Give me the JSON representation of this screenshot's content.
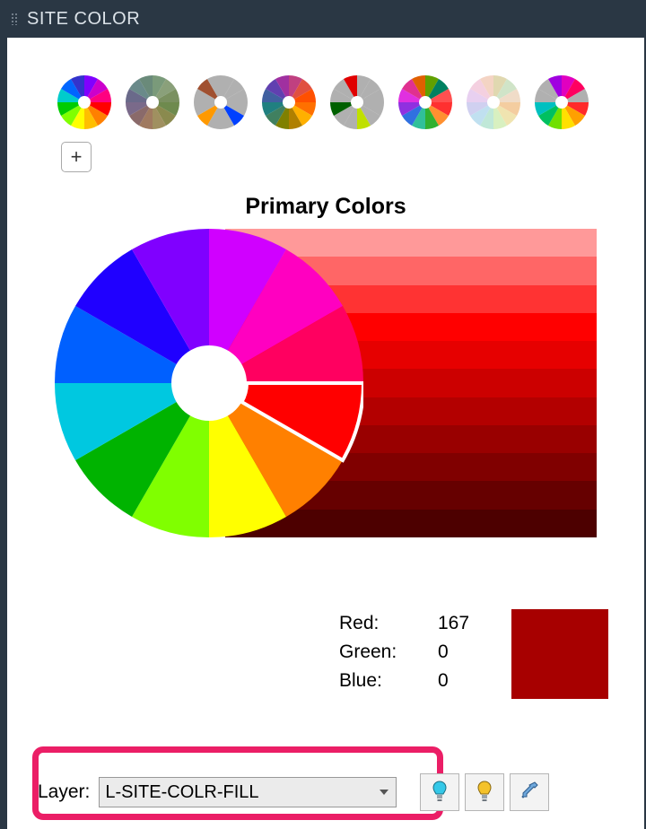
{
  "title": "SITE COLOR",
  "main_heading": "Primary Colors",
  "rgb_labels": {
    "r": "Red:",
    "g": "Green:",
    "b": "Blue:"
  },
  "rgb": {
    "r": 167,
    "g": 0,
    "b": 0
  },
  "swatch_color": "#A70000",
  "layer_label": "Layer:",
  "layer_selected": "L-SITE-COLR-FILL",
  "wheel_colors": [
    "#ff0000",
    "#ff8000",
    "#ffff00",
    "#80ff00",
    "#00b300",
    "#00c8e0",
    "#0060ff",
    "#2000ff",
    "#8000ff",
    "#d000ff",
    "#ff00c0",
    "#ff0060"
  ],
  "wheel_selected_index": 0,
  "shades": [
    "#ff9999",
    "#ff6666",
    "#ff3333",
    "#ff0000",
    "#e60000",
    "#cc0000",
    "#b30000",
    "#990000",
    "#800000",
    "#660000",
    "#4d0000"
  ],
  "palettes": [
    {
      "name": "full",
      "colors": [
        "#ff0000",
        "#ff8000",
        "#ffbf00",
        "#ffff00",
        "#80ff00",
        "#00cc00",
        "#00cccc",
        "#0066ff",
        "#3333cc",
        "#8000ff",
        "#cc00cc",
        "#ff0080"
      ]
    },
    {
      "name": "muted",
      "colors": [
        "#6e8a4e",
        "#8a8a4e",
        "#a09060",
        "#a07a60",
        "#8a6a6a",
        "#7a6a8a",
        "#6a6a8a",
        "#6a8a8a",
        "#6a8a7a",
        "#7a9a7a",
        "#8aa07a",
        "#7a9060"
      ]
    },
    {
      "name": "p3",
      "colors": [
        "#b0b0b0",
        "#0040ff",
        "#b0b0b0",
        "#b0b0b0",
        "#ff9900",
        "#b0b0b0",
        "#b0b0b0",
        "#a05030",
        "#b0b0b0",
        "#b0b0b0",
        "#b0b0b0",
        "#b0b0b0"
      ]
    },
    {
      "name": "p4",
      "colors": [
        "#ff7000",
        "#ffb000",
        "#b08000",
        "#808000",
        "#408060",
        "#208080",
        "#4060a0",
        "#6040b0",
        "#a030a0",
        "#c04080",
        "#e05040",
        "#ff5000"
      ]
    },
    {
      "name": "p5",
      "colors": [
        "#b0b0b0",
        "#b0b0b0",
        "#c0e000",
        "#b0b0b0",
        "#b0b0b0",
        "#006000",
        "#b0b0b0",
        "#b0b0b0",
        "#e00000",
        "#b0b0b0",
        "#b0b0b0",
        "#b0b0b0"
      ]
    },
    {
      "name": "p6",
      "colors": [
        "#ff3030",
        "#ff9030",
        "#30b030",
        "#30c09a",
        "#3070e0",
        "#9030e0",
        "#e030e0",
        "#e03090",
        "#e06000",
        "#60a000",
        "#008060",
        "#ff5050"
      ]
    },
    {
      "name": "pastel",
      "colors": [
        "#f4cda0",
        "#f0e4b0",
        "#d8f0c0",
        "#c0e8d8",
        "#c0e0f0",
        "#d0d0f0",
        "#e8d0f0",
        "#f4d0e0",
        "#f4d4c4",
        "#e0d8b0",
        "#d0e4c8",
        "#f0dcc8"
      ]
    },
    {
      "name": "bright",
      "colors": [
        "#ff2a2a",
        "#ffa000",
        "#ffe000",
        "#70e000",
        "#00c060",
        "#00c0c0",
        "#b0b0b0",
        "#b0b0b0",
        "#a000e0",
        "#e000c0",
        "#ff0060",
        "#b0b0b0"
      ]
    }
  ]
}
